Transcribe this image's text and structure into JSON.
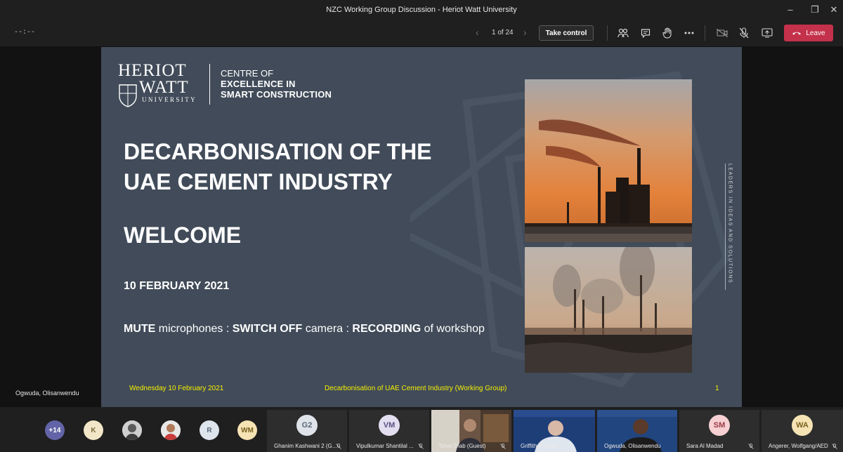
{
  "window": {
    "title": "NZC Working Group Discussion - Heriot Watt University"
  },
  "toolbar": {
    "timer": "--:--",
    "page_count": "1 of 24",
    "take_control_label": "Take control",
    "leave_label": "Leave",
    "icons": [
      "prev-arrow-icon",
      "next-arrow-icon",
      "participants-icon",
      "chat-icon",
      "raise-hand-icon",
      "more-icon",
      "camera-off-icon",
      "mic-off-icon",
      "share-icon",
      "phone-hangup-icon"
    ]
  },
  "stage": {
    "presenter_name": "Ogwuda, Olisanwendu"
  },
  "slide": {
    "logo": {
      "university_line1": "HERIOT",
      "university_line2": "WATT",
      "university_line3": "UNIVERSITY",
      "centre_line1": "CENTRE OF",
      "centre_line2": "EXCELLENCE IN",
      "centre_line3": "SMART CONSTRUCTION"
    },
    "title_line1": "DECARBONISATION OF THE",
    "title_line2": "UAE CEMENT INDUSTRY",
    "welcome": "WELCOME",
    "date": "10 FEBRUARY 2021",
    "instructions": {
      "mute": "MUTE",
      "t1": " microphones : ",
      "switch_off": "SWITCH OFF",
      "t2": " camera : ",
      "recording": "RECORDING",
      "t3": " of workshop"
    },
    "vertical_tag": "LEADERS IN IDEAS AND SOLUTIONS",
    "footer_left": "Wednesday 10 February 2021",
    "footer_mid": "Decarbonisation of UAE Cement Industry (Working Group)",
    "footer_num": "1"
  },
  "participants": {
    "overflow_count": "+14",
    "avatars": [
      {
        "initials": "K",
        "bg": "#f2e6c8",
        "fg": "#7a6a3c"
      },
      {
        "initials": "",
        "bg": "#d9d9d9",
        "fg": "#333"
      },
      {
        "initials": "",
        "bg": "#e9e9e9",
        "fg": "#333"
      },
      {
        "initials": "R",
        "bg": "#dfe5ec",
        "fg": "#566576"
      },
      {
        "initials": "WM",
        "bg": "#f6e3b4",
        "fg": "#7a6120"
      }
    ],
    "tiles": [
      {
        "name": "Ghanim Kashwani 2 (G...",
        "initials": "G2",
        "bg": "#dfe3ea",
        "fg": "#5c6778"
      },
      {
        "name": "Vipulkumar Shantilal ...",
        "initials": "VM",
        "bg": "#e3def0",
        "fg": "#5b4f80"
      },
      {
        "name": "Taher Diab (Guest)",
        "initials": "",
        "bg": "",
        "fg": ""
      },
      {
        "name": "Griffiths, Roger",
        "initials": "",
        "bg": "",
        "fg": ""
      },
      {
        "name": "Ogwuda, Olisanwendu",
        "initials": "",
        "bg": "",
        "fg": ""
      },
      {
        "name": "Sara Al Madad",
        "initials": "SM",
        "bg": "#f6d0d2",
        "fg": "#9a3a44"
      },
      {
        "name": "Angerer, Wolfgang/AED",
        "initials": "WA",
        "bg": "#f6e3b4",
        "fg": "#7a6120"
      }
    ]
  },
  "colors": {
    "leave": "#c4314b",
    "slide_bg": "#414b59",
    "footer_text": "#f5f000",
    "overflow_badge": "#6264a7"
  }
}
